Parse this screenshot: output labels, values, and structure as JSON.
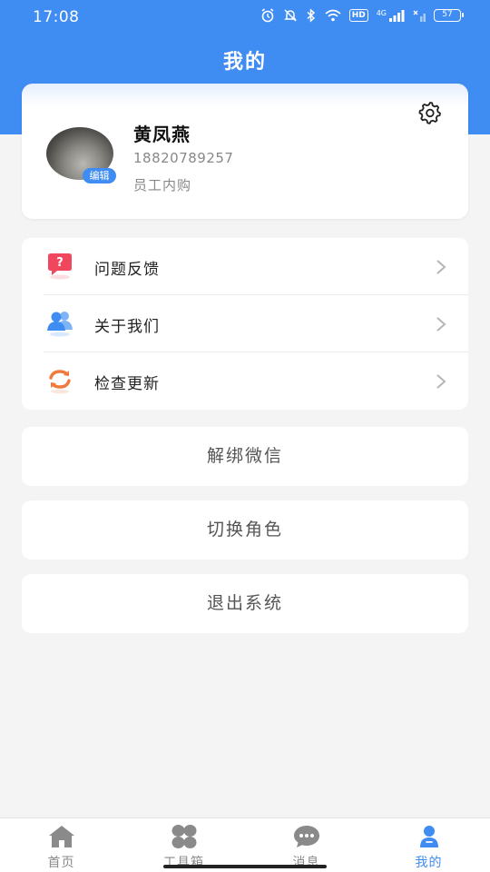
{
  "status_bar": {
    "time": "17:08",
    "hd_badge": "HD",
    "signal_label": "4G",
    "battery": "57"
  },
  "header": {
    "title": "我的",
    "background_color": "#3f8cf3"
  },
  "profile": {
    "name": "黄凤燕",
    "phone": "18820789257",
    "role": "员工内购",
    "avatar_edit_label": "编辑",
    "settings_icon": "gear-icon"
  },
  "menu": {
    "items": [
      {
        "label": "问题反馈",
        "icon": "feedback-icon",
        "icon_color": "#f0475e"
      },
      {
        "label": "关于我们",
        "icon": "users-icon",
        "icon_color": "#3f8cf3"
      },
      {
        "label": "检查更新",
        "icon": "refresh-icon",
        "icon_color": "#f07a3c"
      }
    ]
  },
  "actions": {
    "unbind_wechat": "解绑微信",
    "switch_role": "切换角色",
    "logout": "退出系统"
  },
  "tab_bar": {
    "tabs": [
      {
        "label": "首页",
        "icon": "home-icon",
        "active": false
      },
      {
        "label": "工具箱",
        "icon": "grid-icon",
        "active": false
      },
      {
        "label": "消息",
        "icon": "chat-icon",
        "active": false
      },
      {
        "label": "我的",
        "icon": "person-icon",
        "active": true
      }
    ],
    "active_color": "#3f8cf3",
    "inactive_color": "#8a8a8a"
  }
}
